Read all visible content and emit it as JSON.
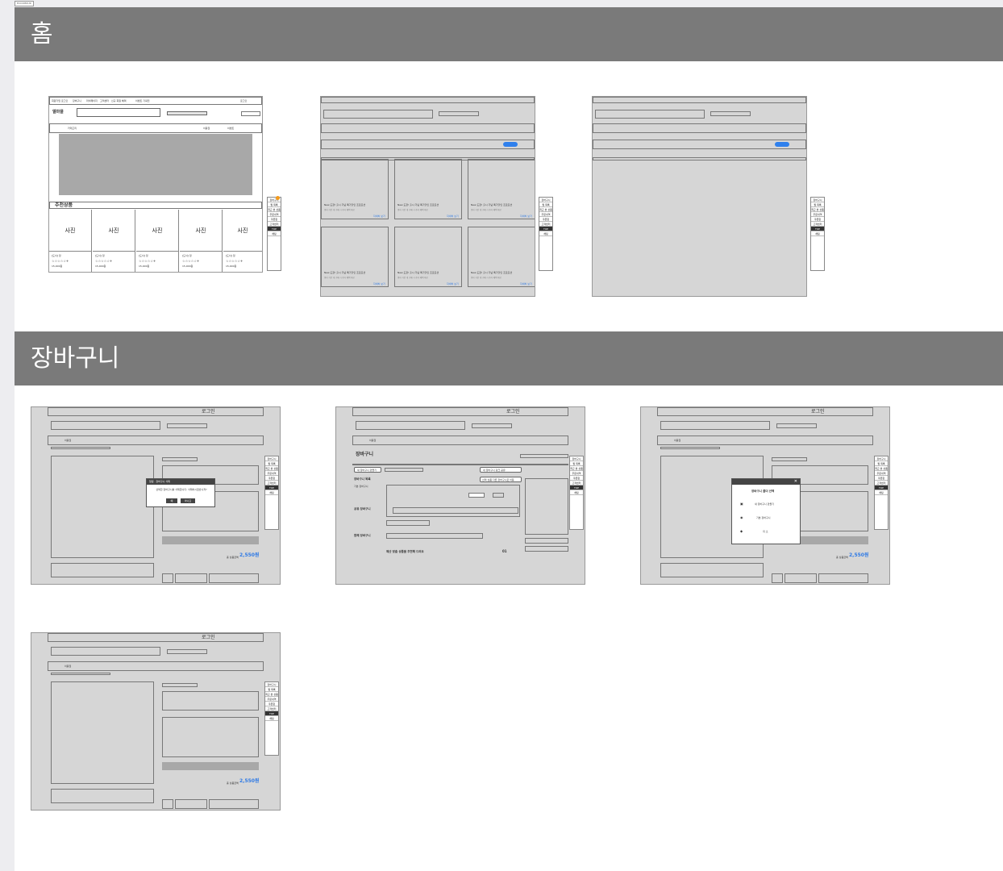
{
  "canvas_tag": "ECCOMOUR",
  "sections": {
    "home": {
      "title": "홈"
    },
    "cart": {
      "title": "장바구니"
    }
  },
  "nav": {
    "login": "로그인",
    "logo": "엘마플",
    "category_button": "카테고리",
    "ticket": "이용권",
    "recommended_label": "추천상품",
    "event_label": "이벤트"
  },
  "home_frame1": {
    "top_links": [
      "회원가입",
      "로그인",
      "장바구니",
      "마이페이지",
      "고객센터",
      "신규 회원 혜택",
      "이벤트 기획전"
    ],
    "promo_title": "추천상품",
    "products": [
      {
        "photo": "사진",
        "brand": "[도서] 정",
        "stars": "☆☆☆☆☆+",
        "price": "15,000원"
      },
      {
        "photo": "사진",
        "brand": "[도서] 정",
        "stars": "☆☆☆☆☆+",
        "price": "15,000원"
      },
      {
        "photo": "사진",
        "brand": "[도서] 정",
        "stars": "☆☆☆☆☆+",
        "price": "15,000원"
      },
      {
        "photo": "사진",
        "brand": "[도서] 정",
        "stars": "☆☆☆☆☆+",
        "price": "15,000원"
      },
      {
        "photo": "사진",
        "brand": "[도서] 정",
        "stars": "☆☆☆☆☆+",
        "price": "15,000원"
      }
    ]
  },
  "home_frame2": {
    "card_title": "New 도장! 출시 기념 특가할인 프로모션",
    "card_sub": "행사 기간 내 구매 시 추가 혜택 제공",
    "card_link": "자세히 보기"
  },
  "quick_menu": [
    "장바구니",
    "찜 목록",
    "최근 본 상품",
    "주문내역",
    "쿠폰함",
    "고객센터",
    "TOP",
    "채팅"
  ],
  "cart": {
    "page_title": "장바구니",
    "new_cart_btn": "새 장바구니 만들기",
    "cart_list_label": "장바구니 목록",
    "default_cart": "기본 장바구니",
    "shared_cart_label": "공유 장바구니",
    "related_label": "함께 장바구니",
    "recommend_text": "예산 맞춤 상품을 추천해 드려요",
    "page_num": "01",
    "total_label": "총 상품금액",
    "total_value": "2,550원",
    "modal1_title": "알림 · 장바구니 삭제",
    "modal1_text": "선택한 장바구니를 삭제합니다. 삭제하시겠습니까?",
    "modal1_ok": "예",
    "modal1_cancel": "아니요",
    "modal2_title": "장바구니 폴더 선택",
    "modal2_options": [
      "새 장바구니 만들기",
      "기본 장바구니",
      "취 소"
    ],
    "share_btn": "내 장바구니 링크 공유",
    "move_btn": "선택 상품 다른 장바구니로 이동"
  },
  "colors": {
    "accent": "#2f80ed",
    "orange": "#f59a1b",
    "bar": "#7a7a7a"
  }
}
